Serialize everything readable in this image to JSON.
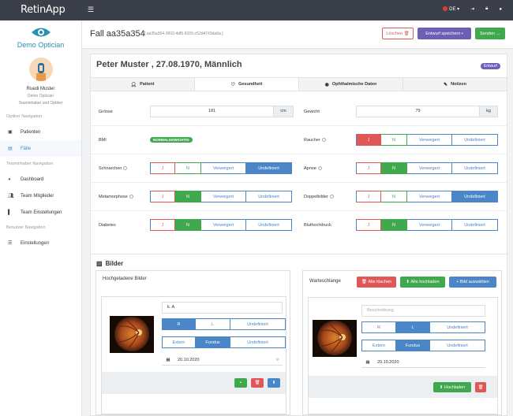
{
  "topbar": {
    "brand": "RetinApp",
    "menu_icon": "hamburger-icon",
    "language": "DE",
    "language_caret": "▾"
  },
  "sidebar": {
    "logo_text": "Demo Optician",
    "user_name": "Ruedi Muster",
    "user_org": "Demo Optician",
    "user_role": "Teaminhaber und Optiker",
    "sections": [
      {
        "title": "Optiker Navigation",
        "items": [
          {
            "label": "Patienten",
            "icon": "clipboard-icon"
          },
          {
            "label": "Fälle",
            "icon": "file-icon",
            "active": true
          }
        ]
      },
      {
        "title": "Teaminhaber Navigation",
        "items": [
          {
            "label": "Dashboard",
            "icon": "dashboard-icon"
          },
          {
            "label": "Team Mitglieder",
            "icon": "users-icon"
          },
          {
            "label": "Team Einstellungen",
            "icon": "book-icon"
          }
        ]
      },
      {
        "title": "Benutzer Navigation",
        "items": [
          {
            "label": "Einstellungen",
            "icon": "sliders-icon"
          }
        ]
      }
    ]
  },
  "header": {
    "title": "Fall aa35a354",
    "case_id": "[ aa35a354-3693-4df5-8155-c52d4743da6a ]",
    "btn_delete": "Löschen",
    "btn_save_draft": "Entwurf speichern",
    "btn_send": "Senden"
  },
  "patient": {
    "title": "Peter Muster , 27.08.1970, Männlich",
    "status_badge": "Entwurf",
    "tabs": [
      {
        "label": "Patient",
        "icon": "user-icon"
      },
      {
        "label": "Gesundheit",
        "icon": "heartbeat-icon",
        "active": true
      },
      {
        "label": "Ophthalmische Daten",
        "icon": "eye-icon"
      },
      {
        "label": "Notizen",
        "icon": "pencil-icon"
      }
    ]
  },
  "health": {
    "groesse_label": "Grösse",
    "groesse_value": "181",
    "groesse_unit": "cm",
    "gewicht_label": "Gewicht",
    "gewicht_value": "79",
    "gewicht_unit": "kg",
    "bmi_label": "BMI",
    "bmi_badge": "NORMALGEWICHTIG",
    "options": {
      "j": "J",
      "n": "N",
      "v": "Verweigert",
      "u": "Undefiniert"
    },
    "raucher_label": "Raucher",
    "raucher_selected": "J",
    "schnarchen_label": "Schnarchen",
    "schnarchen_selected": "Undefiniert",
    "apnoe_label": "Apnoe",
    "apnoe_selected": "N",
    "metamorphose_label": "Metamorphose",
    "metamorphose_selected": "N",
    "doppelbilder_label": "Doppelbilder",
    "doppelbilder_selected": "Undefiniert",
    "diabetes_label": "Diabetes",
    "diabetes_selected": "N",
    "bluthochdruck_label": "Bluthochdruck",
    "bluthochdruck_selected": "N"
  },
  "bilder": {
    "title": "Bilder",
    "uploaded": {
      "title": "Hochgeladene Bilder",
      "description": "k. A.",
      "eye_options": [
        "R",
        "L",
        "Undefiniert"
      ],
      "eye_selected": "R",
      "type_options": [
        "Extern",
        "Fundus",
        "Undefiniert"
      ],
      "type_selected": "Fundus",
      "date": "20.10.2020"
    },
    "queue": {
      "title": "Warteschlange",
      "btn_delete_all": "Alle löschen",
      "btn_upload_all": "Alle hochladen",
      "btn_select_image": "Bild auswählen",
      "description_placeholder": "Beschreibung",
      "eye_options": [
        "R",
        "L",
        "Undefiniert"
      ],
      "eye_selected": "L",
      "type_options": [
        "Extern",
        "Fundus",
        "Undefiniert"
      ],
      "type_selected": "Fundus",
      "date": "20.10.2020",
      "btn_upload": "Hochladen"
    }
  },
  "colors": {
    "topbar": "#3a3f4a",
    "brand_blue": "#2a8fb3",
    "primary": "#4a86c8",
    "success": "#41a94d",
    "danger": "#e05757",
    "purple": "#6c5fb8"
  }
}
